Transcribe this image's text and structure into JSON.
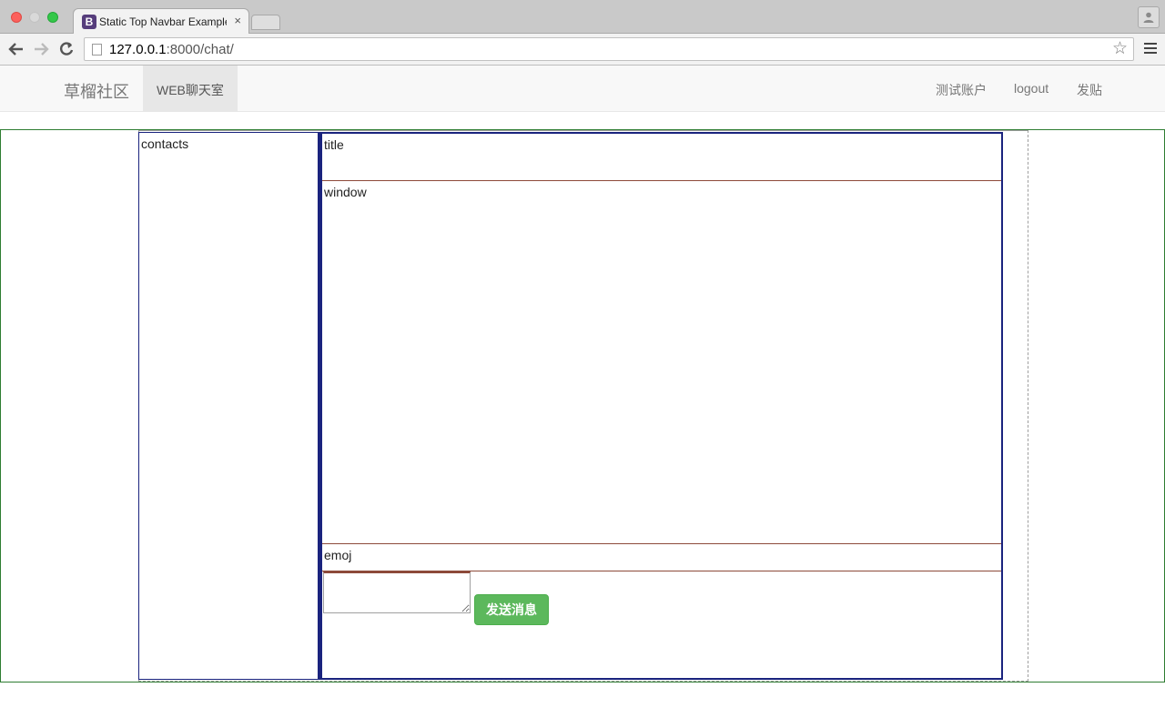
{
  "browser": {
    "tab_title": "Static Top Navbar Example",
    "tab_favicon": "B",
    "tab_close": "×",
    "url_host": "127.0.0.1",
    "url_path": ":8000/chat/",
    "star_icon": "☆"
  },
  "navbar": {
    "brand": "草榴社区",
    "active_item": "WEB聊天室",
    "right_items": [
      "测试账户",
      "logout",
      "发贴"
    ]
  },
  "chat": {
    "contacts_label": "contacts",
    "title_label": "title",
    "window_label": "window",
    "emoj_label": "emoj",
    "message_value": "",
    "send_label": "发送消息"
  },
  "colors": {
    "navbar_bg": "#f8f8f8",
    "send_button": "#5cb85c",
    "panel_border": "#1a237e",
    "outer_border": "#2e7d32"
  }
}
